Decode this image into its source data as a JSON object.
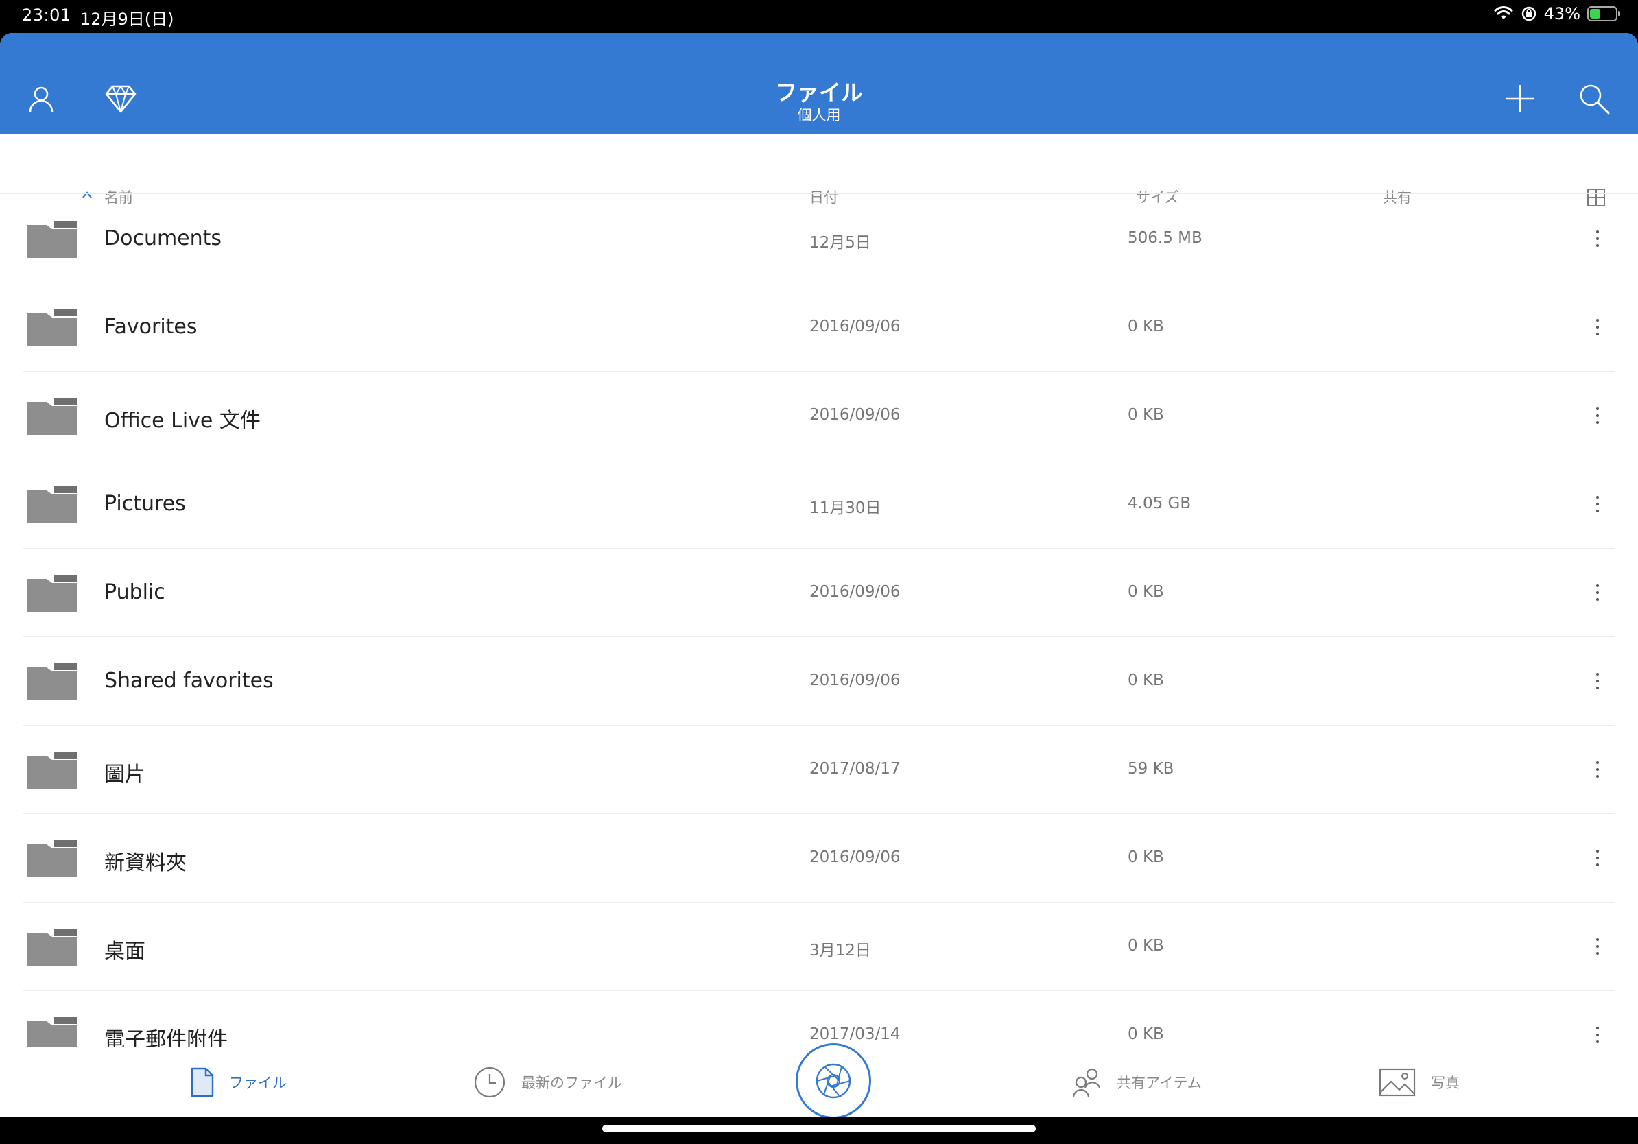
{
  "status_bar": {
    "time": "23:01",
    "date": "12月9日(日)",
    "battery": "43%",
    "battery_level": 0.43
  },
  "header": {
    "title": "ファイル",
    "subtitle": "個人用"
  },
  "columns": {
    "name": "名前",
    "date": "日付",
    "size": "サイズ",
    "shared": "共有"
  },
  "files": [
    {
      "name": "Documents",
      "date": "12月5日",
      "size": "506.5 MB"
    },
    {
      "name": "Favorites",
      "date": "2016/09/06",
      "size": "0 KB"
    },
    {
      "name": "Office Live 文件",
      "date": "2016/09/06",
      "size": "0 KB"
    },
    {
      "name": "Pictures",
      "date": "11月30日",
      "size": "4.05 GB"
    },
    {
      "name": "Public",
      "date": "2016/09/06",
      "size": "0 KB"
    },
    {
      "name": "Shared favorites",
      "date": "2016/09/06",
      "size": "0 KB"
    },
    {
      "name": "圖片",
      "date": "2017/08/17",
      "size": "59 KB"
    },
    {
      "name": "新資料夾",
      "date": "2016/09/06",
      "size": "0 KB"
    },
    {
      "name": "桌面",
      "date": "3月12日",
      "size": "0 KB"
    },
    {
      "name": "電子郵件附件",
      "date": "2017/03/14",
      "size": "0 KB"
    }
  ],
  "tabs": {
    "files": "ファイル",
    "recent": "最新のファイル",
    "shared": "共有アイテム",
    "photos": "写真"
  },
  "colors": {
    "accent": "#3479d2",
    "folder": "#8e8e8e"
  }
}
